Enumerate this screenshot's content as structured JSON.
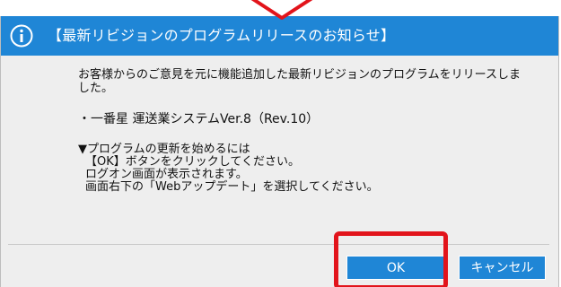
{
  "dialog": {
    "title": "【最新リビジョンのプログラムリリースのお知らせ】",
    "message_line1": "お客様からのご意見を元に機能追加した最新リビジョンのプログラムをリリースしま",
    "message_line2": "した。",
    "product_line": "・一番星 運送業システムVer.8（Rev.10）",
    "steps": [
      "▼プログラムの更新を始めるには",
      "【OK】ボタンをクリックしてください。",
      "ログオン画面が表示されます。",
      "画面右下の「Webアップデート」を選択してください。"
    ],
    "ok_label": "OK",
    "cancel_label": "キャンセル"
  },
  "icons": {
    "title_icon": "info-icon",
    "callout": "callout-arrow-icon"
  },
  "colors": {
    "accent_blue": "#1f86d6",
    "highlight_red": "#e2141b",
    "dialog_bg": "#eeeeee"
  }
}
